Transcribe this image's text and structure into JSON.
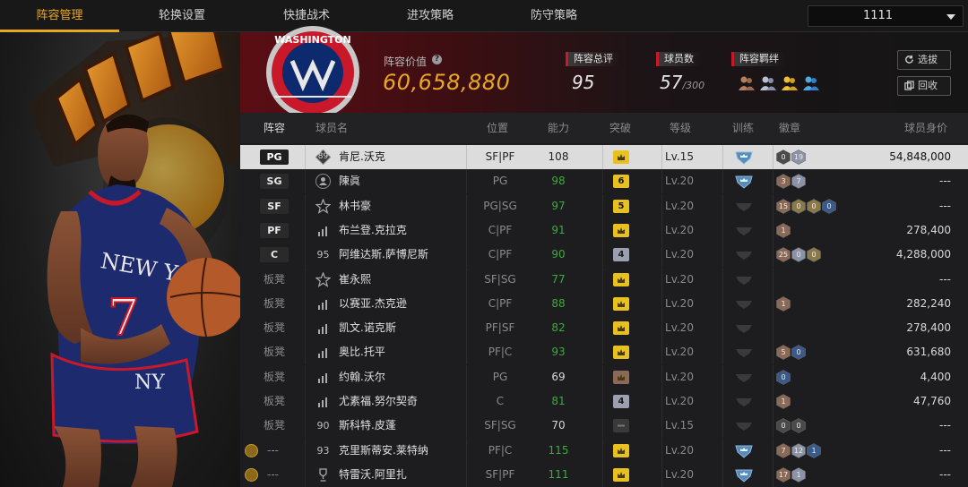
{
  "nav": {
    "tabs": [
      "阵容管理",
      "轮换设置",
      "快捷战术",
      "进攻策略",
      "防守策略"
    ],
    "active_tab": 0,
    "roster_selector": "1111"
  },
  "header": {
    "value_label": "阵容价值",
    "value_amount": "60,658,880",
    "overall_label": "阵容总评",
    "overall_value": "95",
    "player_count_label": "球员数",
    "player_count": "57",
    "player_capacity": "/300",
    "bond_label": "阵容羁绊",
    "scout_button": "选拔",
    "recycle_button": "回收",
    "team_logo_text": "WASHINGTON"
  },
  "columns": {
    "lineup": "阵容",
    "name": "球员名",
    "position": "位置",
    "rating": "能力",
    "breakthrough": "突破",
    "level": "等级",
    "training": "训练",
    "badges": "徽章",
    "salary": "球员身价"
  },
  "rows": [
    {
      "slot": "PG",
      "slot_type": "starter",
      "icon": "89",
      "name": "肯尼.沃克",
      "position": "SF|PF",
      "rating": "108",
      "rating_green": false,
      "brk": "crown-gold",
      "level": "Lv.15",
      "train": "blue",
      "badges": [
        [
          "0",
          "gray"
        ],
        [
          "19",
          "silver"
        ]
      ],
      "salary": "54,848,000",
      "selected": true
    },
    {
      "slot": "SG",
      "slot_type": "starter",
      "icon": "person",
      "name": "陳眞",
      "position": "PG",
      "rating": "98",
      "rating_green": true,
      "brk": "6",
      "level": "Lv.20",
      "train": "blue",
      "badges": [
        [
          "3",
          "bronze"
        ],
        [
          "7",
          "silver"
        ]
      ],
      "salary": "---"
    },
    {
      "slot": "SF",
      "slot_type": "starter",
      "icon": "star",
      "name": "林书豪",
      "position": "PG|SG",
      "rating": "97",
      "rating_green": true,
      "brk": "5",
      "level": "Lv.20",
      "train": "gray",
      "badges": [
        [
          "15",
          "bronze"
        ],
        [
          "0",
          "gold"
        ],
        [
          "0",
          "gold"
        ],
        [
          "0",
          "blue"
        ]
      ],
      "salary": "---"
    },
    {
      "slot": "PF",
      "slot_type": "starter",
      "icon": "bars",
      "name": "布兰登.克拉克",
      "position": "C|PF",
      "rating": "91",
      "rating_green": true,
      "brk": "crown-gold",
      "level": "Lv.20",
      "train": "gray",
      "badges": [
        [
          "1",
          "bronze"
        ]
      ],
      "salary": "278,400"
    },
    {
      "slot": "C",
      "slot_type": "starter",
      "icon": "95",
      "name": "阿维达斯.萨博尼斯",
      "position": "C|PF",
      "rating": "90",
      "rating_green": true,
      "brk": "4",
      "level": "Lv.20",
      "train": "gray",
      "badges": [
        [
          "25",
          "bronze"
        ],
        [
          "0",
          "silver"
        ],
        [
          "0",
          "gold"
        ]
      ],
      "salary": "4,288,000"
    },
    {
      "slot": "板凳",
      "slot_type": "bench",
      "icon": "star",
      "name": "崔永熙",
      "position": "SF|SG",
      "rating": "77",
      "rating_green": true,
      "brk": "crown-gold",
      "level": "Lv.20",
      "train": "gray",
      "badges": [],
      "salary": "---"
    },
    {
      "slot": "板凳",
      "slot_type": "bench",
      "icon": "bars",
      "name": "以赛亚.杰克逊",
      "position": "C|PF",
      "rating": "88",
      "rating_green": true,
      "brk": "crown-gold",
      "level": "Lv.20",
      "train": "gray",
      "badges": [
        [
          "1",
          "bronze"
        ]
      ],
      "salary": "282,240"
    },
    {
      "slot": "板凳",
      "slot_type": "bench",
      "icon": "bars",
      "name": "凯文.诺克斯",
      "position": "PF|SF",
      "rating": "82",
      "rating_green": true,
      "brk": "crown-gold",
      "level": "Lv.20",
      "train": "gray",
      "badges": [],
      "salary": "278,400"
    },
    {
      "slot": "板凳",
      "slot_type": "bench",
      "icon": "bars",
      "name": "奥比.托平",
      "position": "PF|C",
      "rating": "93",
      "rating_green": true,
      "brk": "crown-gold",
      "level": "Lv.20",
      "train": "gray",
      "badges": [
        [
          "5",
          "bronze"
        ],
        [
          "0",
          "blue"
        ]
      ],
      "salary": "631,680"
    },
    {
      "slot": "板凳",
      "slot_type": "bench",
      "icon": "bars",
      "name": "约翰.沃尔",
      "position": "PG",
      "rating": "69",
      "rating_green": false,
      "brk": "crown-bronze",
      "level": "Lv.20",
      "train": "gray",
      "badges": [
        [
          "0",
          "blue"
        ]
      ],
      "salary": "4,400"
    },
    {
      "slot": "板凳",
      "slot_type": "bench",
      "icon": "bars",
      "name": "尤素福.努尔契奇",
      "position": "C",
      "rating": "81",
      "rating_green": true,
      "brk": "4",
      "level": "Lv.20",
      "train": "gray",
      "badges": [
        [
          "1",
          "bronze"
        ]
      ],
      "salary": "47,760"
    },
    {
      "slot": "板凳",
      "slot_type": "bench",
      "icon": "90",
      "name": "斯科特.皮蓬",
      "position": "SF|SG",
      "rating": "70",
      "rating_green": false,
      "brk": "dash",
      "level": "Lv.15",
      "train": "gray",
      "badges": [
        [
          "0",
          "gray"
        ],
        [
          "0",
          "gray"
        ]
      ],
      "salary": "---"
    },
    {
      "slot": "---",
      "slot_type": "other",
      "icon": "93",
      "name": "克里斯蒂安.莱特纳",
      "position": "PF|C",
      "rating": "115",
      "rating_green": true,
      "brk": "crown-gold",
      "level": "Lv.20",
      "train": "blue",
      "badges": [
        [
          "7",
          "bronze"
        ],
        [
          "12",
          "silver"
        ],
        [
          "1",
          "blue"
        ]
      ],
      "salary": "---"
    },
    {
      "slot": "---",
      "slot_type": "other",
      "icon": "trophy",
      "name": "特雷沃.阿里扎",
      "position": "SF|PF",
      "rating": "111",
      "rating_green": true,
      "brk": "crown-gold",
      "level": "Lv.20",
      "train": "blue",
      "badges": [
        [
          "17",
          "bronze"
        ],
        [
          "1",
          "silver"
        ]
      ],
      "salary": "---"
    }
  ],
  "colors": {
    "accent": "#e8a825",
    "header_red": "#5a0e14",
    "rating_green": "#3caa3c",
    "selected_row": "#dcdcdc"
  }
}
